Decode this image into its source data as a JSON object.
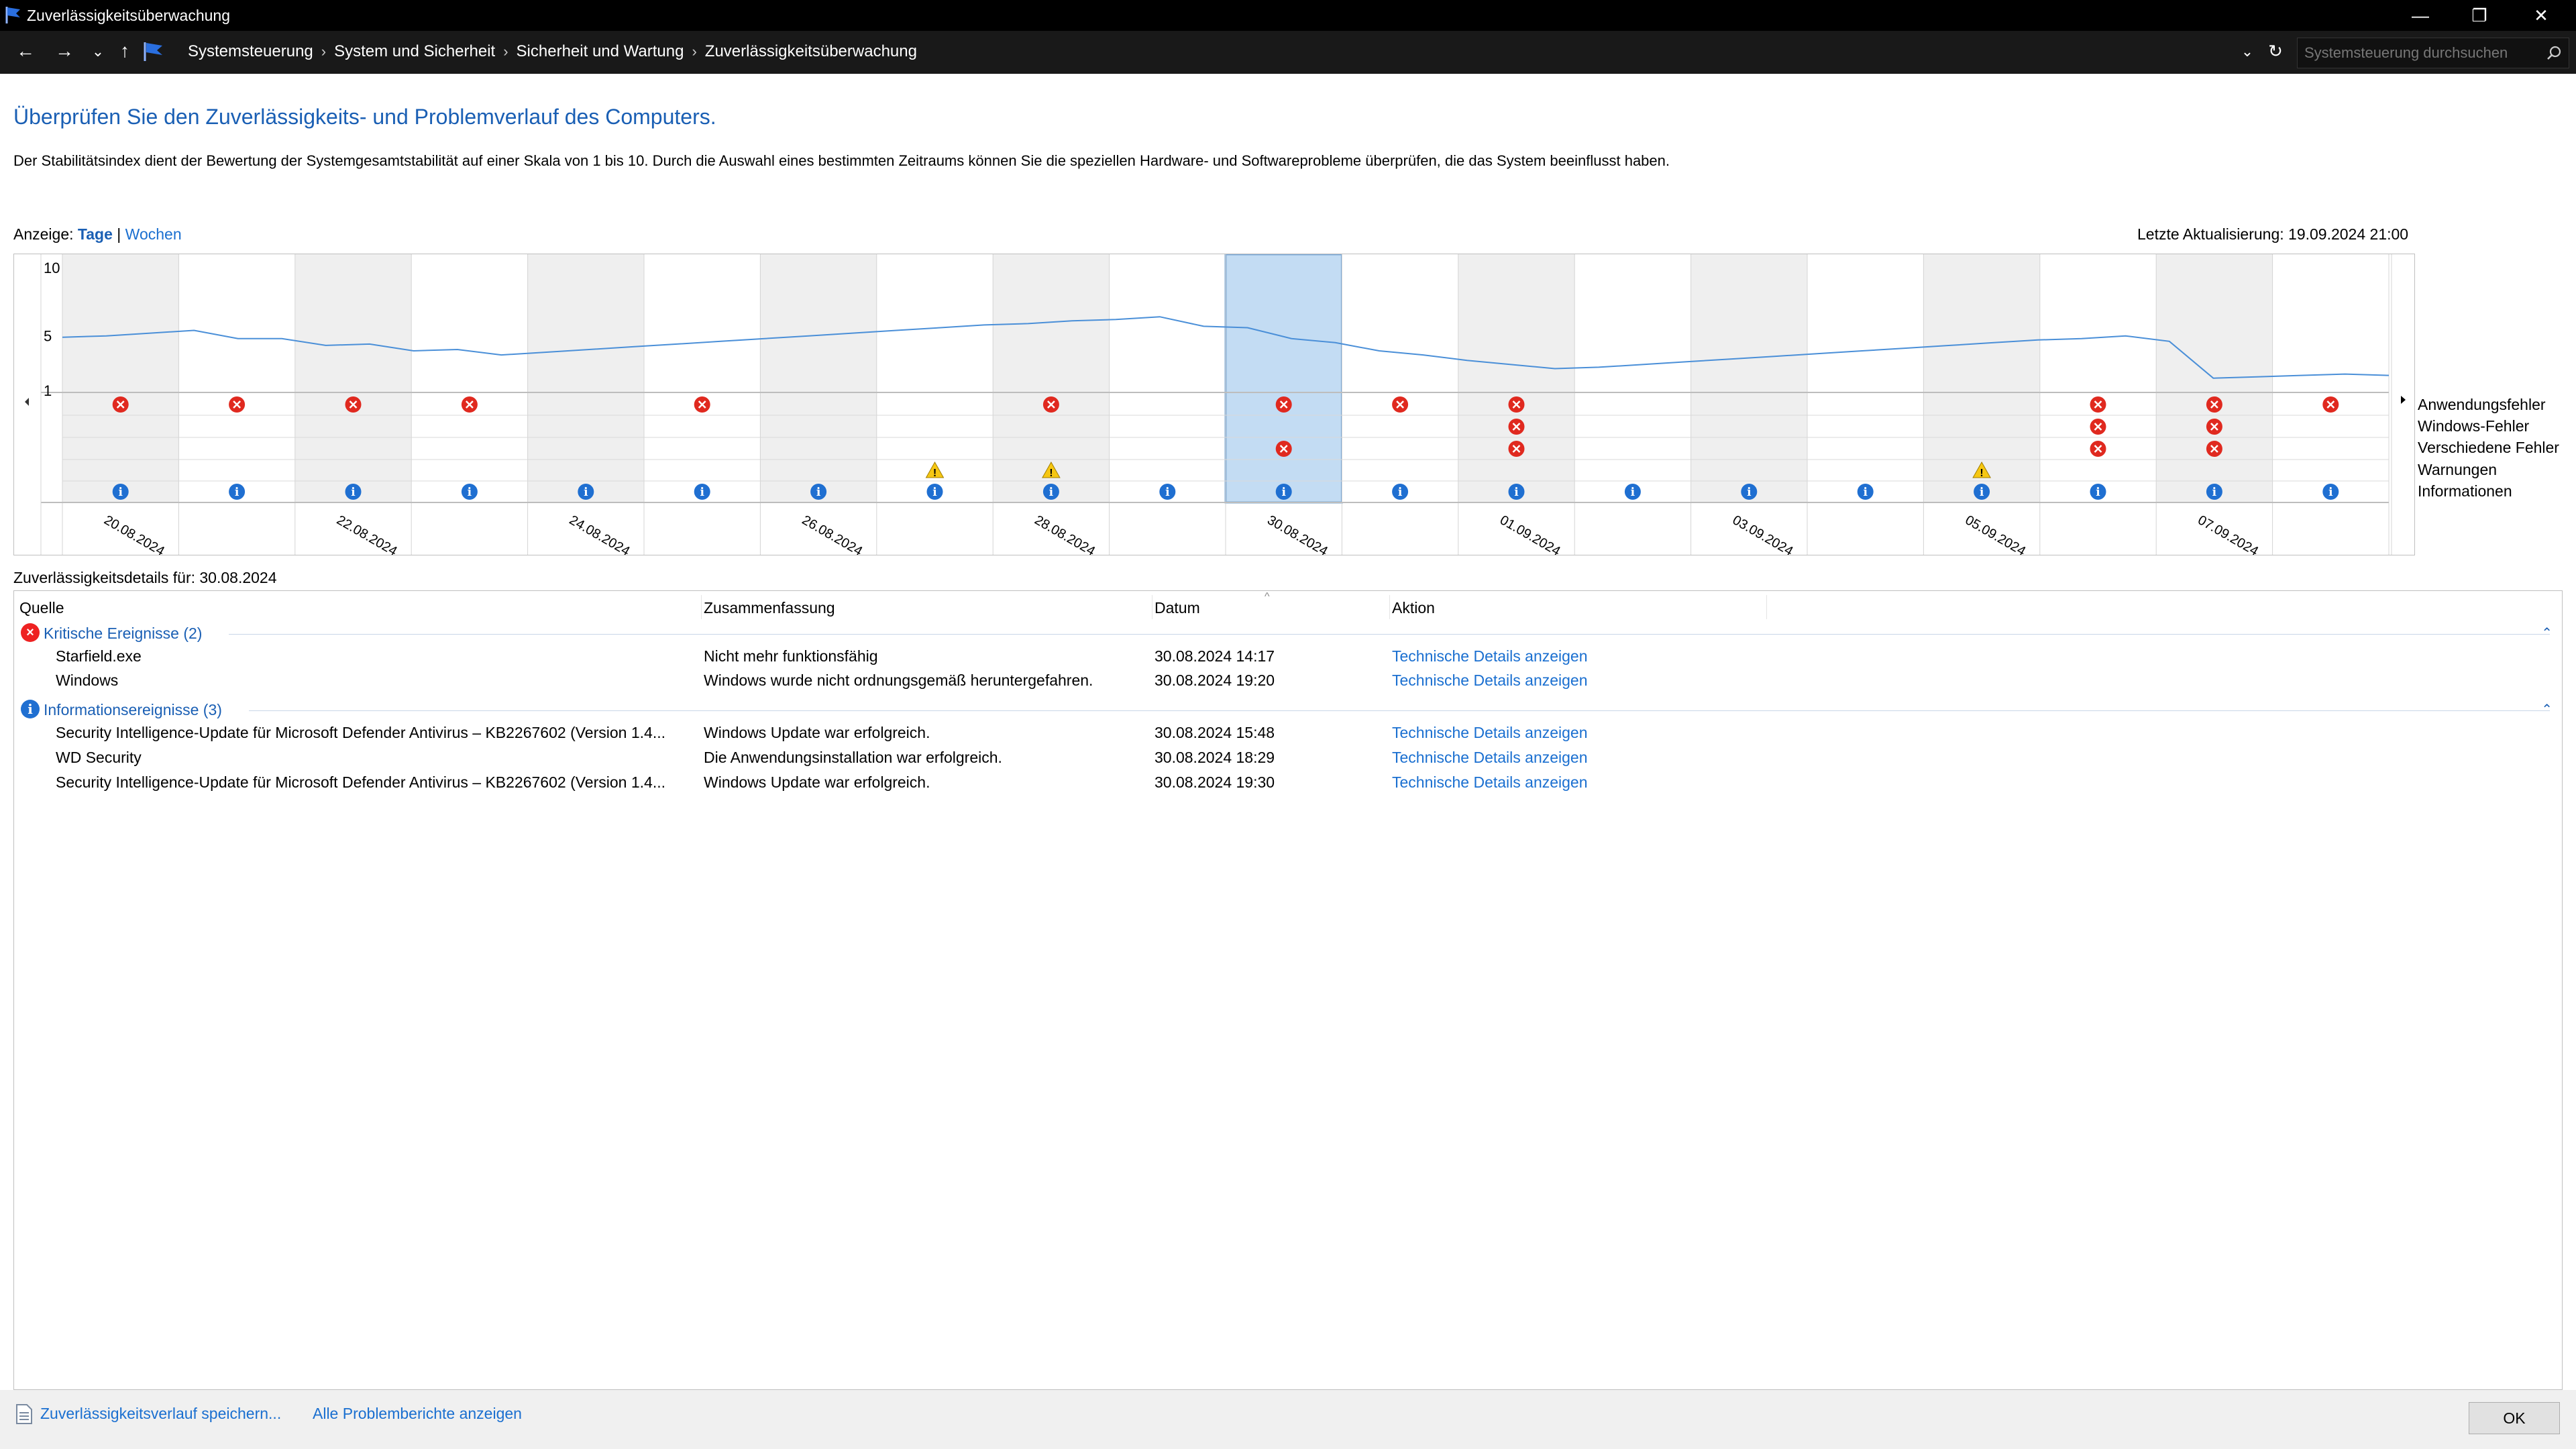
{
  "window": {
    "title": "Zuverlässigkeitsüberwachung"
  },
  "breadcrumb": [
    "Systemsteuerung",
    "System und Sicherheit",
    "Sicherheit und Wartung",
    "Zuverlässigkeitsüberwachung"
  ],
  "search": {
    "placeholder": "Systemsteuerung durchsuchen"
  },
  "heading": "Überprüfen Sie den Zuverlässigkeits- und Problemverlauf des Computers.",
  "description": "Der Stabilitätsindex dient der Bewertung der Systemgesamtstabilität auf einer Skala von 1 bis 10. Durch die Auswahl eines bestimmten Zeitraums können Sie die speziellen Hardware- und Softwareprobleme überprüfen, die das System beeinflusst haben.",
  "view": {
    "label": "Anzeige:",
    "days": "Tage",
    "separator": "|",
    "weeks": "Wochen"
  },
  "last_update": "Letzte Aktualisierung: 19.09.2024 21:00",
  "chart_data": {
    "type": "line",
    "y_ticks": [
      "10",
      "5",
      "1"
    ],
    "ylim": [
      1,
      10
    ],
    "x_labels": [
      "20.08.2024",
      "22.08.2024",
      "24.08.2024",
      "26.08.2024",
      "28.08.2024",
      "30.08.2024",
      "01.09.2024",
      "03.09.2024",
      "05.09.2024",
      "07.09.2024"
    ],
    "columns": 20,
    "selected_column": 10,
    "stability_index": [
      4.9,
      5.0,
      5.2,
      5.4,
      4.8,
      4.8,
      4.3,
      4.4,
      3.9,
      4.0,
      3.6,
      3.8,
      4.0,
      4.2,
      4.4,
      4.6,
      4.8,
      5.0,
      5.2,
      5.4,
      5.6,
      5.8,
      5.9,
      6.1,
      6.2,
      6.4,
      5.7,
      5.6,
      4.8,
      4.5,
      3.9,
      3.6,
      3.2,
      2.9,
      2.6,
      2.7,
      2.9,
      3.1,
      3.3,
      3.5,
      3.7,
      3.9,
      4.1,
      4.3,
      4.5,
      4.7,
      4.8,
      5.0,
      4.6,
      1.9,
      2.0,
      2.1,
      2.2,
      2.1
    ],
    "legend": [
      "Anwendungsfehler",
      "Windows-Fehler",
      "Verschiedene Fehler",
      "Warnungen",
      "Informationen"
    ],
    "events": {
      "Anwendungsfehler": [
        0,
        1,
        2,
        3,
        5,
        8,
        10,
        11,
        12,
        17,
        18,
        19
      ],
      "Windows-Fehler": [
        12,
        17,
        18
      ],
      "Verschiedene Fehler": [
        10,
        12,
        17,
        18
      ],
      "Warnungen": [
        7,
        8,
        16
      ],
      "Informationen": [
        0,
        1,
        2,
        3,
        4,
        5,
        6,
        7,
        8,
        9,
        10,
        11,
        12,
        13,
        14,
        15,
        16,
        17,
        18,
        19
      ]
    }
  },
  "details": {
    "label": "Zuverlässigkeitsdetails für: 30.08.2024",
    "columns": [
      "Quelle",
      "Zusammenfassung",
      "Datum",
      "Aktion"
    ],
    "groups": [
      {
        "title": "Kritische Ereignisse (2)",
        "kind": "error",
        "rows": [
          {
            "source": "Starfield.exe",
            "summary": "Nicht mehr funktionsfähig",
            "date": "30.08.2024 14:17",
            "action": "Technische Details anzeigen"
          },
          {
            "source": "Windows",
            "summary": "Windows wurde nicht ordnungsgemäß heruntergefahren.",
            "date": "30.08.2024 19:20",
            "action": "Technische Details anzeigen"
          }
        ]
      },
      {
        "title": "Informationsereignisse (3)",
        "kind": "info",
        "rows": [
          {
            "source": "Security Intelligence-Update für Microsoft Defender Antivirus – KB2267602 (Version 1.4...",
            "summary": "Windows Update war erfolgreich.",
            "date": "30.08.2024 15:48",
            "action": "Technische Details anzeigen"
          },
          {
            "source": "WD Security",
            "summary": "Die Anwendungsinstallation war erfolgreich.",
            "date": "30.08.2024 18:29",
            "action": "Technische Details anzeigen"
          },
          {
            "source": "Security Intelligence-Update für Microsoft Defender Antivirus – KB2267602 (Version 1.4...",
            "summary": "Windows Update war erfolgreich.",
            "date": "30.08.2024 19:30",
            "action": "Technische Details anzeigen"
          }
        ]
      }
    ]
  },
  "footer": {
    "save": "Zuverlässigkeitsverlauf speichern...",
    "reports": "Alle Problemberichte anzeigen",
    "ok": "OK"
  }
}
